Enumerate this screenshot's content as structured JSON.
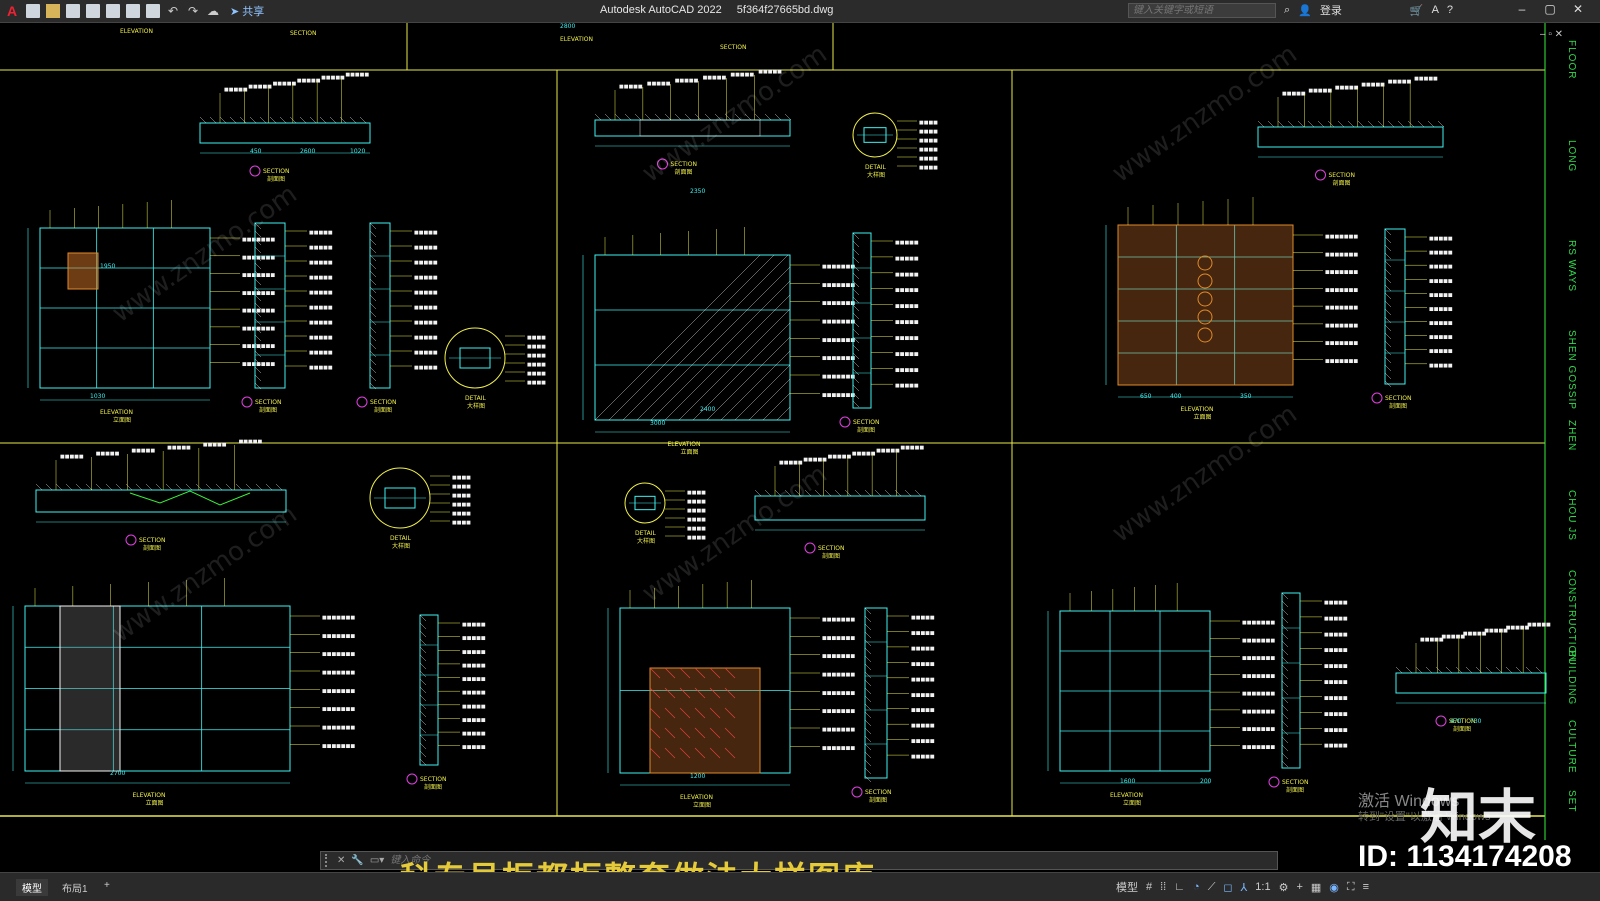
{
  "app": {
    "title": "Autodesk AutoCAD 2022",
    "file": "5f364f27665bd.dwg",
    "share": "共享",
    "search_placeholder": "键入关键字或短语",
    "login": "登录",
    "logo_letter": "A"
  },
  "command": {
    "placeholder": "键入命令"
  },
  "tabs": [
    "模型",
    "布局1",
    "+"
  ],
  "status": {
    "model_label": "模型",
    "scale": "1:1"
  },
  "right_labels": [
    "FLOOR",
    "LONG",
    "RS WAYS",
    "SHEN GOSSIP",
    "ZHEN",
    "CHOU JS",
    "CONSTRUCTION",
    "BUILDING",
    "CULTURE",
    "SET"
  ],
  "drawing": {
    "labels": {
      "elevation": "ELEVATION",
      "section": "SECTION",
      "detail": "DETAIL",
      "lmian": "立面图",
      "pmian": "剖面图",
      "dayang": "大样图"
    },
    "dims": [
      "2800",
      "1030",
      "3000",
      "2350",
      "650",
      "2700",
      "1200",
      "1600",
      "450",
      "2600",
      "1020",
      "2400",
      "350",
      "400",
      "200",
      "470",
      "730",
      "1950"
    ]
  },
  "overlay": {
    "banner": "科专号柜都柜整套做法大样图库",
    "id_text": "ID: 1134174208",
    "brand": "知末",
    "activate": "激活 Windows",
    "activate_sub": "转到\"设置\"以激活 Windows"
  },
  "colors": {
    "frame": "#e8e84a",
    "cyan": "#3ff2f2",
    "yellow": "#f0f04a",
    "white": "#f2f2f2",
    "red": "#f04040",
    "green": "#38f038",
    "orange": "#e08a2a",
    "magenta": "#e040e0"
  }
}
